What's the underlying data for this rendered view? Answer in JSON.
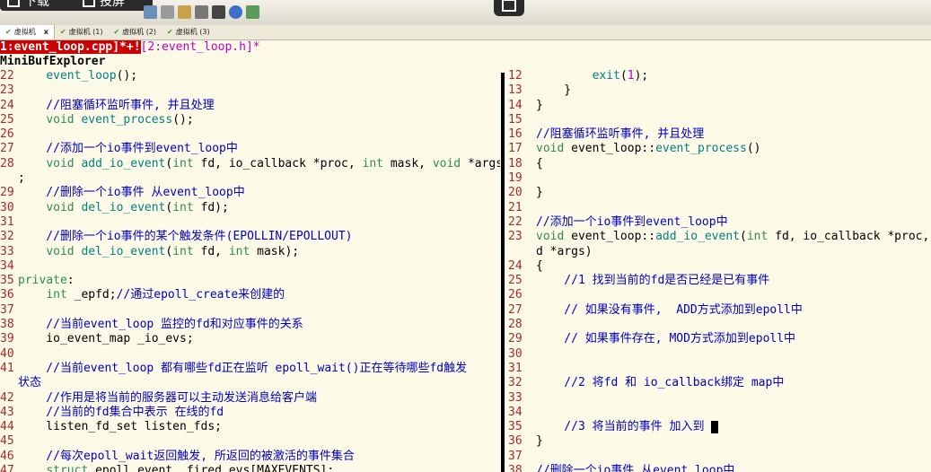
{
  "overlay": {
    "download_label": "下载",
    "fullscreen_label": "投屏"
  },
  "tabs": [
    {
      "label": "虚拟机",
      "active": true,
      "close": "x"
    },
    {
      "label": "虚拟机 (1)"
    },
    {
      "label": "虚拟机 (2)"
    },
    {
      "label": "虚拟机 (3)"
    }
  ],
  "buffers": {
    "active": "1:event_loop.cpp]*+!",
    "other": "[2:event_loop.h]*"
  },
  "minibuf_title": "MiniBufExplorer",
  "left_lines": [
    {
      "n": "22",
      "t": [
        [
          "tx",
          "    "
        ],
        [
          "fn",
          "event_loop"
        ],
        [
          "tx",
          "();"
        ]
      ]
    },
    {
      "n": "23",
      "t": []
    },
    {
      "n": "24",
      "t": [
        [
          "cm",
          "    //阻塞循环监听事件, 并且处理"
        ]
      ]
    },
    {
      "n": "25",
      "t": [
        [
          "tx",
          "    "
        ],
        [
          "kw",
          "void"
        ],
        [
          "tx",
          " "
        ],
        [
          "fn",
          "event_process"
        ],
        [
          "tx",
          "();"
        ]
      ]
    },
    {
      "n": "26",
      "t": []
    },
    {
      "n": "27",
      "t": [
        [
          "cm",
          "    //添加一个io事件到event_loop中"
        ]
      ]
    },
    {
      "n": "28",
      "t": [
        [
          "tx",
          "    "
        ],
        [
          "kw",
          "void"
        ],
        [
          "tx",
          " "
        ],
        [
          "fn",
          "add_io_event"
        ],
        [
          "tx",
          "("
        ],
        [
          "kw",
          "int"
        ],
        [
          "tx",
          " fd, io_callback *proc, "
        ],
        [
          "kw",
          "int"
        ],
        [
          "tx",
          " mask, "
        ],
        [
          "kw",
          "void"
        ],
        [
          "tx",
          " *args)"
        ]
      ]
    },
    {
      "n": "",
      "t": [
        [
          "tx",
          ";"
        ]
      ]
    },
    {
      "n": "29",
      "t": [
        [
          "cm",
          "    //删除一个io事件 从event_loop中"
        ]
      ]
    },
    {
      "n": "30",
      "t": [
        [
          "tx",
          "    "
        ],
        [
          "kw",
          "void"
        ],
        [
          "tx",
          " "
        ],
        [
          "fn",
          "del_io_event"
        ],
        [
          "tx",
          "("
        ],
        [
          "kw",
          "int"
        ],
        [
          "tx",
          " fd);"
        ]
      ]
    },
    {
      "n": "31",
      "t": []
    },
    {
      "n": "32",
      "t": [
        [
          "cm",
          "    //删除一个io事件的某个触发条件(EPOLLIN/EPOLLOUT)"
        ]
      ]
    },
    {
      "n": "33",
      "t": [
        [
          "tx",
          "    "
        ],
        [
          "kw",
          "void"
        ],
        [
          "tx",
          " "
        ],
        [
          "fn",
          "del_io_event"
        ],
        [
          "tx",
          "("
        ],
        [
          "kw",
          "int"
        ],
        [
          "tx",
          " fd, "
        ],
        [
          "kw",
          "int"
        ],
        [
          "tx",
          " mask);"
        ]
      ]
    },
    {
      "n": "34",
      "t": []
    },
    {
      "n": "35",
      "t": [
        [
          "kw",
          "private"
        ],
        [
          "tx",
          ":"
        ]
      ]
    },
    {
      "n": "36",
      "t": [
        [
          "tx",
          "    "
        ],
        [
          "kw",
          "int"
        ],
        [
          "tx",
          " _epfd;"
        ],
        [
          "cm",
          "//通过epoll_create来创建的"
        ]
      ]
    },
    {
      "n": "37",
      "t": []
    },
    {
      "n": "38",
      "t": [
        [
          "cm",
          "    //当前event_loop 监控的fd和对应事件的关系"
        ]
      ]
    },
    {
      "n": "39",
      "t": [
        [
          "tx",
          "    io_event_map _io_evs;"
        ]
      ]
    },
    {
      "n": "40",
      "t": []
    },
    {
      "n": "41",
      "t": [
        [
          "cm",
          "    //当前event_loop 都有哪些fd正在监听 epoll_wait()正在等待哪些fd触发"
        ]
      ]
    },
    {
      "n": "",
      "t": [
        [
          "cm",
          "状态"
        ]
      ]
    },
    {
      "n": "42",
      "t": [
        [
          "cm",
          "    //作用是将当前的服务器可以主动发送消息给客户端"
        ]
      ]
    },
    {
      "n": "43",
      "t": [
        [
          "cm",
          "    //当前的fd集合中表示 在线的fd"
        ]
      ]
    },
    {
      "n": "44",
      "t": [
        [
          "tx",
          "    listen_fd_set listen_fds;"
        ]
      ]
    },
    {
      "n": "45",
      "t": []
    },
    {
      "n": "46",
      "t": [
        [
          "cm",
          "    //每次epoll_wait返回触发, 所返回的被激活的事件集合"
        ]
      ]
    },
    {
      "n": "47",
      "t": [
        [
          "tx",
          "    "
        ],
        [
          "kw",
          "struct"
        ],
        [
          "tx",
          " epoll_event _fired_evs[MAXEVENTS];"
        ]
      ]
    }
  ],
  "right_lines": [
    {
      "n": "12",
      "t": [
        [
          "tx",
          "        "
        ],
        [
          "fn",
          "exit"
        ],
        [
          "tx",
          "("
        ],
        [
          "nm",
          "1"
        ],
        [
          "tx",
          ");"
        ]
      ]
    },
    {
      "n": "13",
      "t": [
        [
          "tx",
          "    }"
        ]
      ]
    },
    {
      "n": "14",
      "t": [
        [
          "tx",
          "}"
        ]
      ]
    },
    {
      "n": "15",
      "t": []
    },
    {
      "n": "16",
      "t": [
        [
          "cm",
          "//阻塞循环监听事件, 并且处理"
        ]
      ]
    },
    {
      "n": "17",
      "t": [
        [
          "kw",
          "void"
        ],
        [
          "tx",
          " event_loop::"
        ],
        [
          "fn",
          "event_process"
        ],
        [
          "tx",
          "()"
        ]
      ]
    },
    {
      "n": "18",
      "t": [
        [
          "tx",
          "{"
        ]
      ]
    },
    {
      "n": "19",
      "t": []
    },
    {
      "n": "20",
      "t": [
        [
          "tx",
          "}"
        ]
      ]
    },
    {
      "n": "21",
      "t": []
    },
    {
      "n": "22",
      "t": [
        [
          "cm",
          "//添加一个io事件到event_loop中"
        ]
      ]
    },
    {
      "n": "23",
      "t": [
        [
          "kw",
          "void"
        ],
        [
          "tx",
          " event_loop::"
        ],
        [
          "fn",
          "add_io_event"
        ],
        [
          "tx",
          "("
        ],
        [
          "kw",
          "int"
        ],
        [
          "tx",
          " fd, io_callback *proc, i"
        ]
      ]
    },
    {
      "n": "",
      "t": [
        [
          "tx",
          "d *args)"
        ]
      ]
    },
    {
      "n": "24",
      "t": [
        [
          "tx",
          "{"
        ]
      ]
    },
    {
      "n": "25",
      "t": [
        [
          "cm",
          "    //1 找到当前的fd是否已经是已有事件"
        ]
      ]
    },
    {
      "n": "26",
      "t": []
    },
    {
      "n": "27",
      "t": [
        [
          "cm",
          "    // 如果没有事件,  ADD方式添加到epoll中"
        ]
      ]
    },
    {
      "n": "28",
      "t": []
    },
    {
      "n": "29",
      "t": [
        [
          "cm",
          "    // 如果事件存在, MOD方式添加到epoll中"
        ]
      ]
    },
    {
      "n": "30",
      "t": []
    },
    {
      "n": "31",
      "t": []
    },
    {
      "n": "32",
      "t": [
        [
          "cm",
          "    //2 将fd 和 io_callback绑定 map中"
        ]
      ]
    },
    {
      "n": "33",
      "t": []
    },
    {
      "n": "34",
      "t": []
    },
    {
      "n": "35",
      "t": [
        [
          "cm",
          "    //3 将当前的事件 加入到 "
        ]
      ],
      "cursor": true
    },
    {
      "n": "36",
      "t": [
        [
          "tx",
          "}"
        ]
      ]
    },
    {
      "n": "37",
      "t": []
    },
    {
      "n": "38",
      "t": [
        [
          "cm",
          "//删除一个io事件 从event_loop中"
        ]
      ]
    }
  ],
  "colors": {
    "background": "#fdfae8",
    "line_number": "#a52a2a",
    "comment": "#0000c0",
    "keyword": "#2e8b57",
    "function": "#008080",
    "number": "#c000c0",
    "active_buffer_bg": "#cc0000",
    "other_buffer": "#c000c0"
  },
  "icons": [
    "download-icon",
    "fullscreen-icon",
    "camera-icon",
    "toolbar-icons"
  ]
}
